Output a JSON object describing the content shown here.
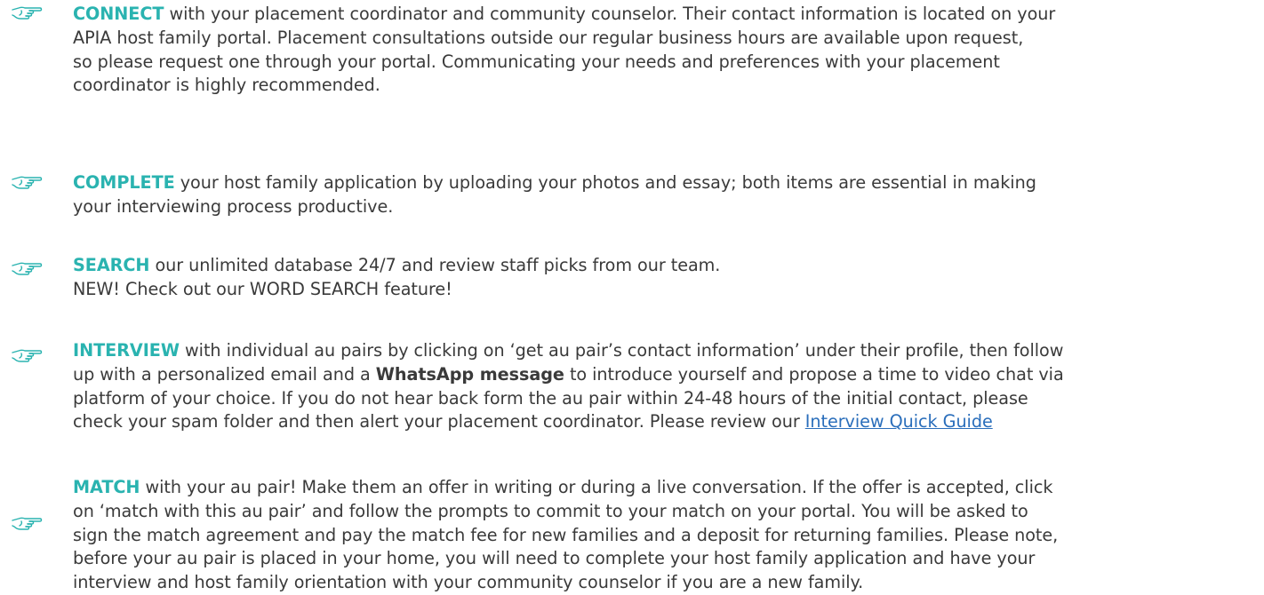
{
  "accent_color": "#2ab3b0",
  "link_color": "#2a6ebb",
  "text_color": "#3a3a3a",
  "steps": {
    "connect": {
      "icon": "pointing-hand-icon",
      "keyword": "CONNECT",
      "l1": " with your placement coordinator and community counselor. Their contact information is located on your",
      "l2": "APIA host family portal. Placement consultations outside our regular business hours are available upon request,",
      "l3": "so please request one through your portal. Communicating your needs and preferences with your placement",
      "l4": "coordinator is highly recommended."
    },
    "complete": {
      "icon": "pointing-hand-icon",
      "keyword": "COMPLETE",
      "l1": " your host family application by uploading your photos and essay; both items are essential in making",
      "l2": "your interviewing process productive."
    },
    "search": {
      "icon": "pointing-hand-icon",
      "keyword": "SEARCH",
      "l1": " our unlimited database 24/7 and review staff picks from our team.",
      "l2": "NEW! Check out our WORD SEARCH feature!"
    },
    "interview": {
      "icon": "pointing-hand-icon",
      "keyword": "INTERVIEW",
      "l1": " with individual au pairs by clicking on ‘get au pair’s contact information’ under their profile, then follow",
      "l2a": "up with a personalized email and a ",
      "l2b": "WhatsApp message",
      "l2c": " to introduce yourself and propose a time to video chat via",
      "l3": "platform of your choice. If you do not hear back form the au pair within 24-48 hours of the initial contact, please",
      "l4a": "check your spam folder and then alert your placement coordinator. Please review our ",
      "link": "Interview Quick Guide"
    },
    "match": {
      "icon": "pointing-hand-icon",
      "keyword": "MATCH",
      "l1": " with your au pair! Make them an offer in writing or during a live conversation. If the offer is accepted, click",
      "l2": "on ‘match with this au pair’ and follow the prompts to commit to your match on your portal. You will be asked to",
      "l3": "sign the match agreement and pay the match fee for new families and a deposit for returning families. Please note,",
      "l4": "before your au pair is placed in your home, you will need to complete your host family application and have your",
      "l5": "interview and host family orientation with your community counselor if you are a new family."
    }
  }
}
